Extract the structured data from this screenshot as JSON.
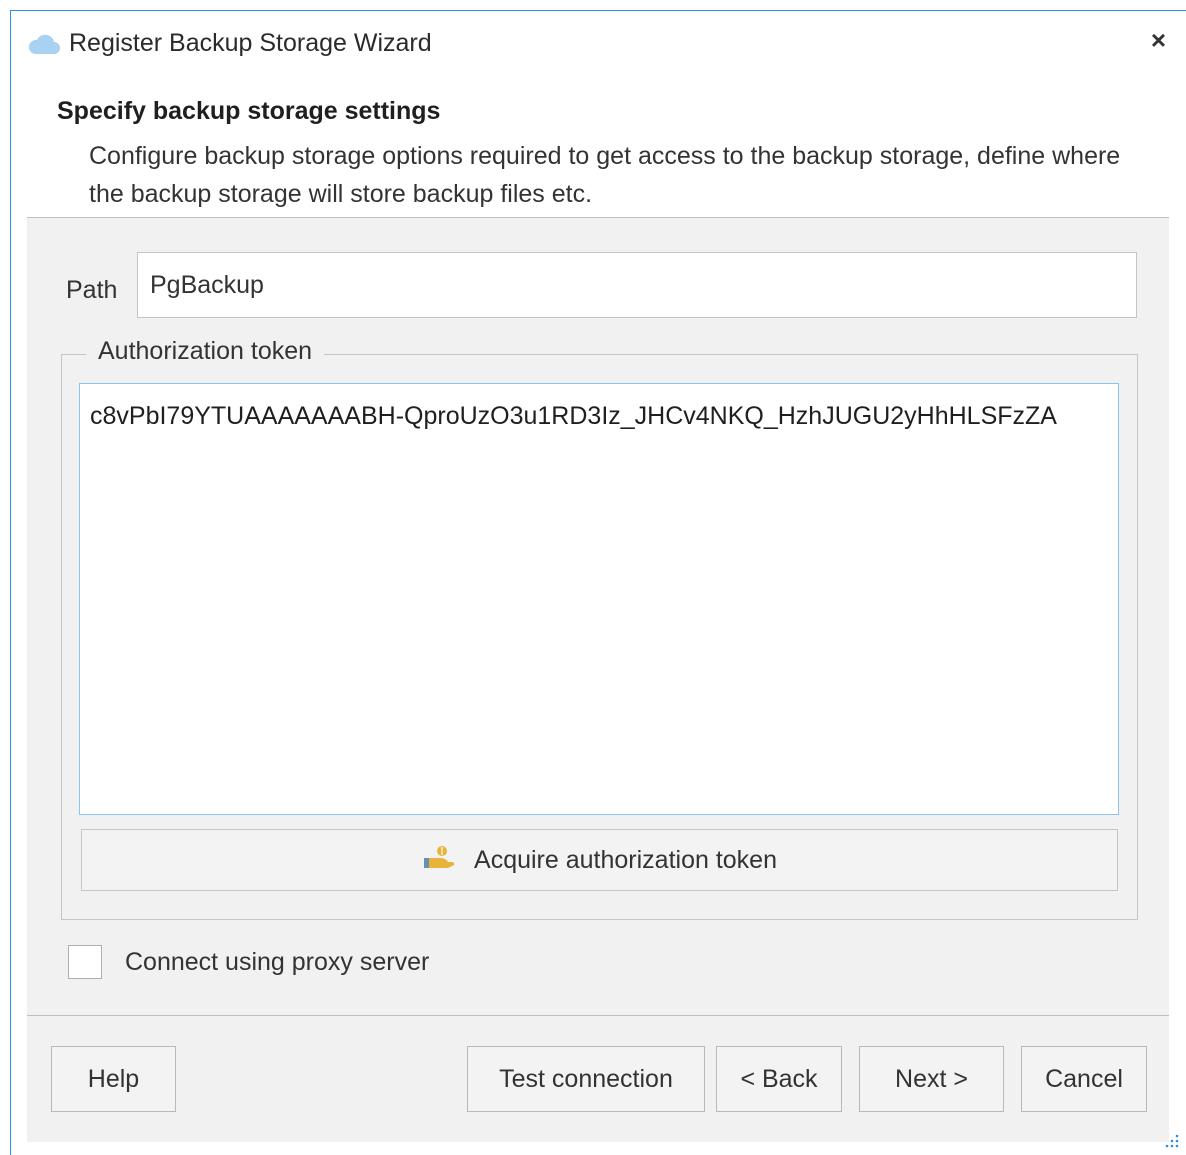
{
  "window": {
    "title": "Register Backup Storage Wizard",
    "title_icon": "cloud-icon",
    "close_glyph": "×"
  },
  "header": {
    "title": "Specify backup storage settings",
    "description": "Configure backup storage options required to get access to the backup storage, define where the backup storage will store backup files etc."
  },
  "form": {
    "path_label": "Path",
    "path_value": "PgBackup",
    "auth_group_label": "Authorization token",
    "auth_token_value": "c8vPbI79YTUAAAAAAABH-QproUzO3u1RD3Iz_JHCv4NKQ_HzhJUGU2yHhHLSFzZA",
    "acquire_button_label": "Acquire authorization token",
    "acquire_icon": "key-hand-icon",
    "proxy_label": "Connect using proxy server",
    "proxy_checked": false
  },
  "footer": {
    "help_label": "Help",
    "test_label": "Test connection",
    "back_label": "< Back",
    "next_label": "Next >",
    "cancel_label": "Cancel"
  },
  "colors": {
    "window_border": "#2f8fdc",
    "panel_bg": "#f1f1f1",
    "focus_border": "#8cc5ea",
    "icon_cloud": "#a9d1f2",
    "icon_key": "#e8b33a"
  }
}
